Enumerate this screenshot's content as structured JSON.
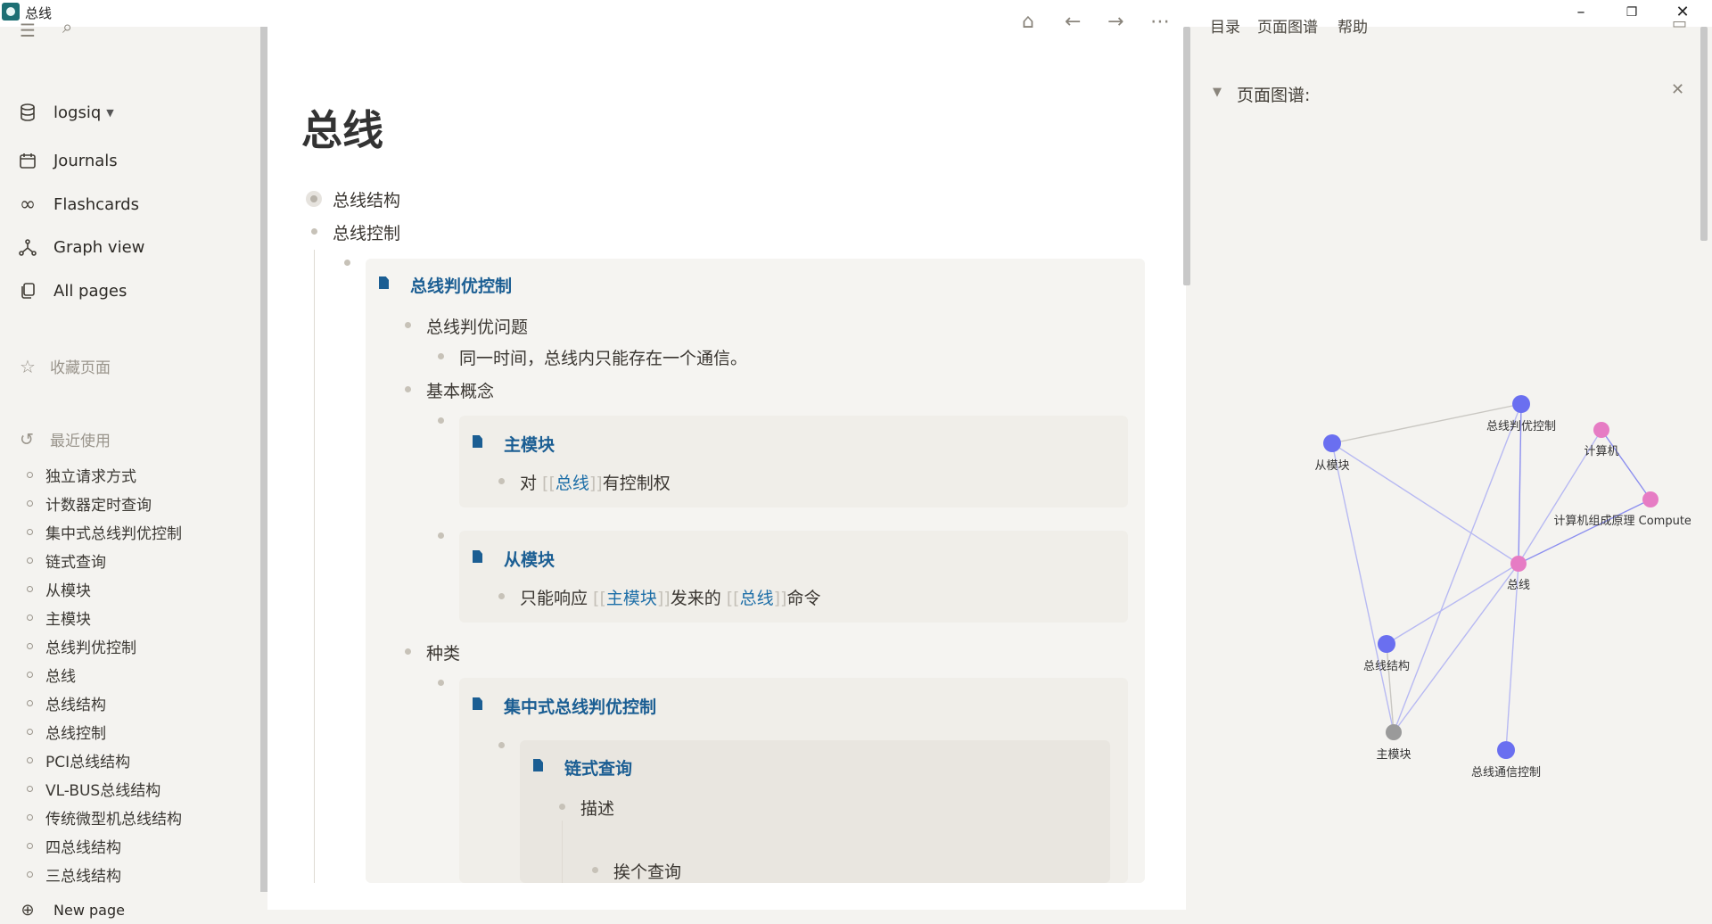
{
  "window": {
    "title": "总线",
    "minimize": "–",
    "maximize": "❐",
    "close": "✕"
  },
  "sidebar": {
    "graph_name": "logsiq",
    "nav": [
      {
        "label": "Journals",
        "icon": "calendar-icon"
      },
      {
        "label": "Flashcards",
        "icon": "infinity-icon"
      },
      {
        "label": "Graph view",
        "icon": "graph-icon"
      },
      {
        "label": "All pages",
        "icon": "pages-icon"
      }
    ],
    "favorites_label": "收藏页面",
    "recent_label": "最近使用",
    "recent": [
      "独立请求方式",
      "计数器定时查询",
      "集中式总线判优控制",
      "链式查询",
      "从模块",
      "主模块",
      "总线判优控制",
      "总线",
      "总线结构",
      "总线控制",
      "PCI总线结构",
      "VL-BUS总线结构",
      "传统微型机总线结构",
      "四总线结构",
      "三总线结构"
    ],
    "new_page": "New page"
  },
  "main": {
    "page_title": "总线",
    "blocks": {
      "b1": "总线结构",
      "b2": "总线控制",
      "ref1_title": "总线判优控制",
      "r1_a": "总线判优问题",
      "r1_a1": "同一时间，总线内只能存在一个通信。",
      "r1_b": "基本概念",
      "ref2_title": "主模块",
      "ref2_prefix": "对 ",
      "ref2_link": "总线",
      "ref2_suffix": "有控制权",
      "ref3_title": "从模块",
      "ref3_prefix": "只能响应 ",
      "ref3_link1": "主模块",
      "ref3_mid": "发来的 ",
      "ref3_link2": "总线",
      "ref3_suffix": "命令",
      "r1_c": "种类",
      "ref4_title": "集中式总线判优控制",
      "ref5_title": "链式查询",
      "r5_a": "描述",
      "r5_a1": "挨个查询"
    },
    "bracket_open": "[[",
    "bracket_close": "]]"
  },
  "right_panel": {
    "tabs": [
      "目录",
      "页面图谱",
      "帮助"
    ],
    "section_title": "页面图谱:",
    "graph": {
      "nodes": [
        {
          "id": "n1",
          "label": "总线判优控制",
          "color": "#6a6ff0"
        },
        {
          "id": "n2",
          "label": "从模块",
          "color": "#6a6ff0"
        },
        {
          "id": "n3",
          "label": "计算机",
          "color": "#e67cc4"
        },
        {
          "id": "n4",
          "label": "计算机组成原理 Computer C",
          "color": "#e67cc4"
        },
        {
          "id": "n5",
          "label": "总线",
          "color": "#e67cc4"
        },
        {
          "id": "n6",
          "label": "总线结构",
          "color": "#6a6ff0"
        },
        {
          "id": "n7",
          "label": "主模块",
          "color": "#9a9a9a"
        },
        {
          "id": "n8",
          "label": "总线通信控制",
          "color": "#6a6ff0"
        }
      ]
    }
  },
  "colors": {
    "accent_link": "#1b5e93",
    "graph_blue": "#6a6ff0",
    "graph_pink": "#e67cc4",
    "graph_gray": "#9a9a9a"
  }
}
